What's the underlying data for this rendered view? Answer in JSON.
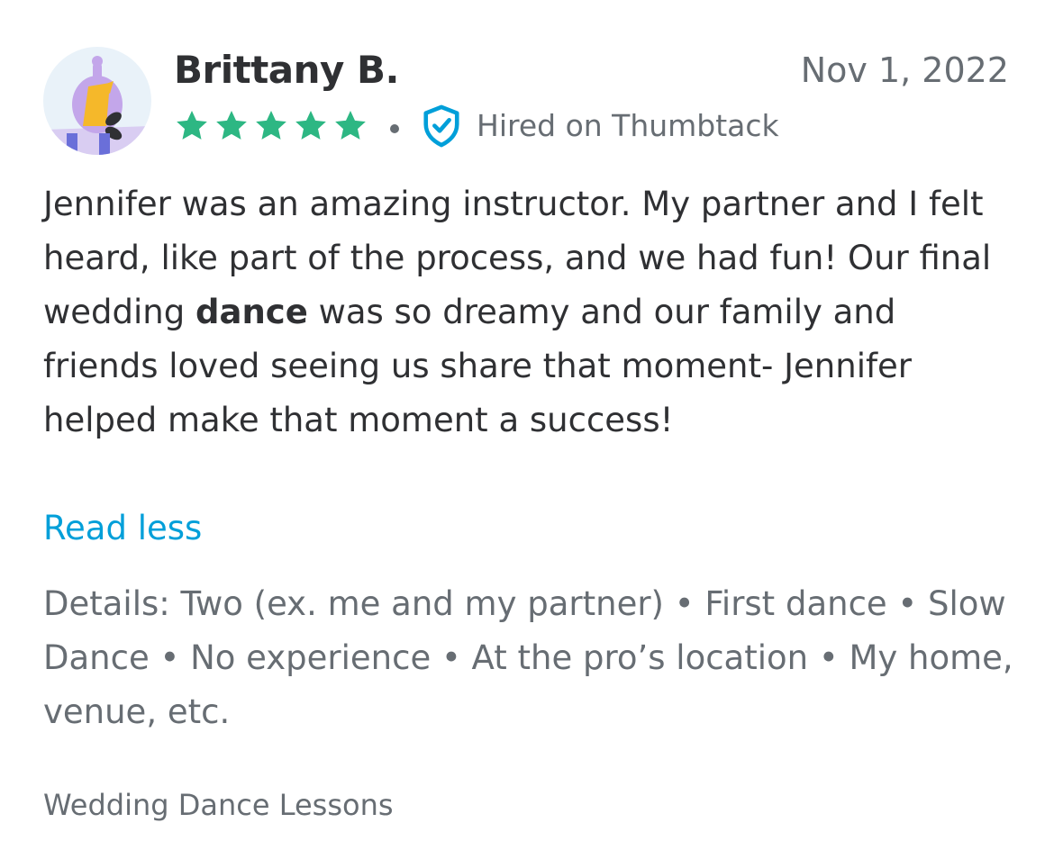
{
  "review": {
    "reviewer_name": "Brittany B.",
    "date": "Nov 1, 2022",
    "rating": 5,
    "rating_max": 5,
    "star_color": "#2db783",
    "verified_label": "Hired on Thumbtack",
    "verified_icon": "shield-check-icon",
    "verified_color": "#009fd9",
    "text_before_bold": "Jennifer was an amazing instructor. My partner and I felt heard, like part of the process, and we had fun! Our final wedding ",
    "text_bold": "dance",
    "text_after_bold": " was so dreamy and our family and friends loved seeing us share that moment- Jennifer helped make that moment a success!",
    "read_less_label": "Read less",
    "link_color": "#009fd9",
    "details": "Details: Two (ex. me and my partner) • First dance • Slow Dance • No experience • At the pro’s location • My home, venue, etc.",
    "category": "Wedding Dance Lessons"
  }
}
